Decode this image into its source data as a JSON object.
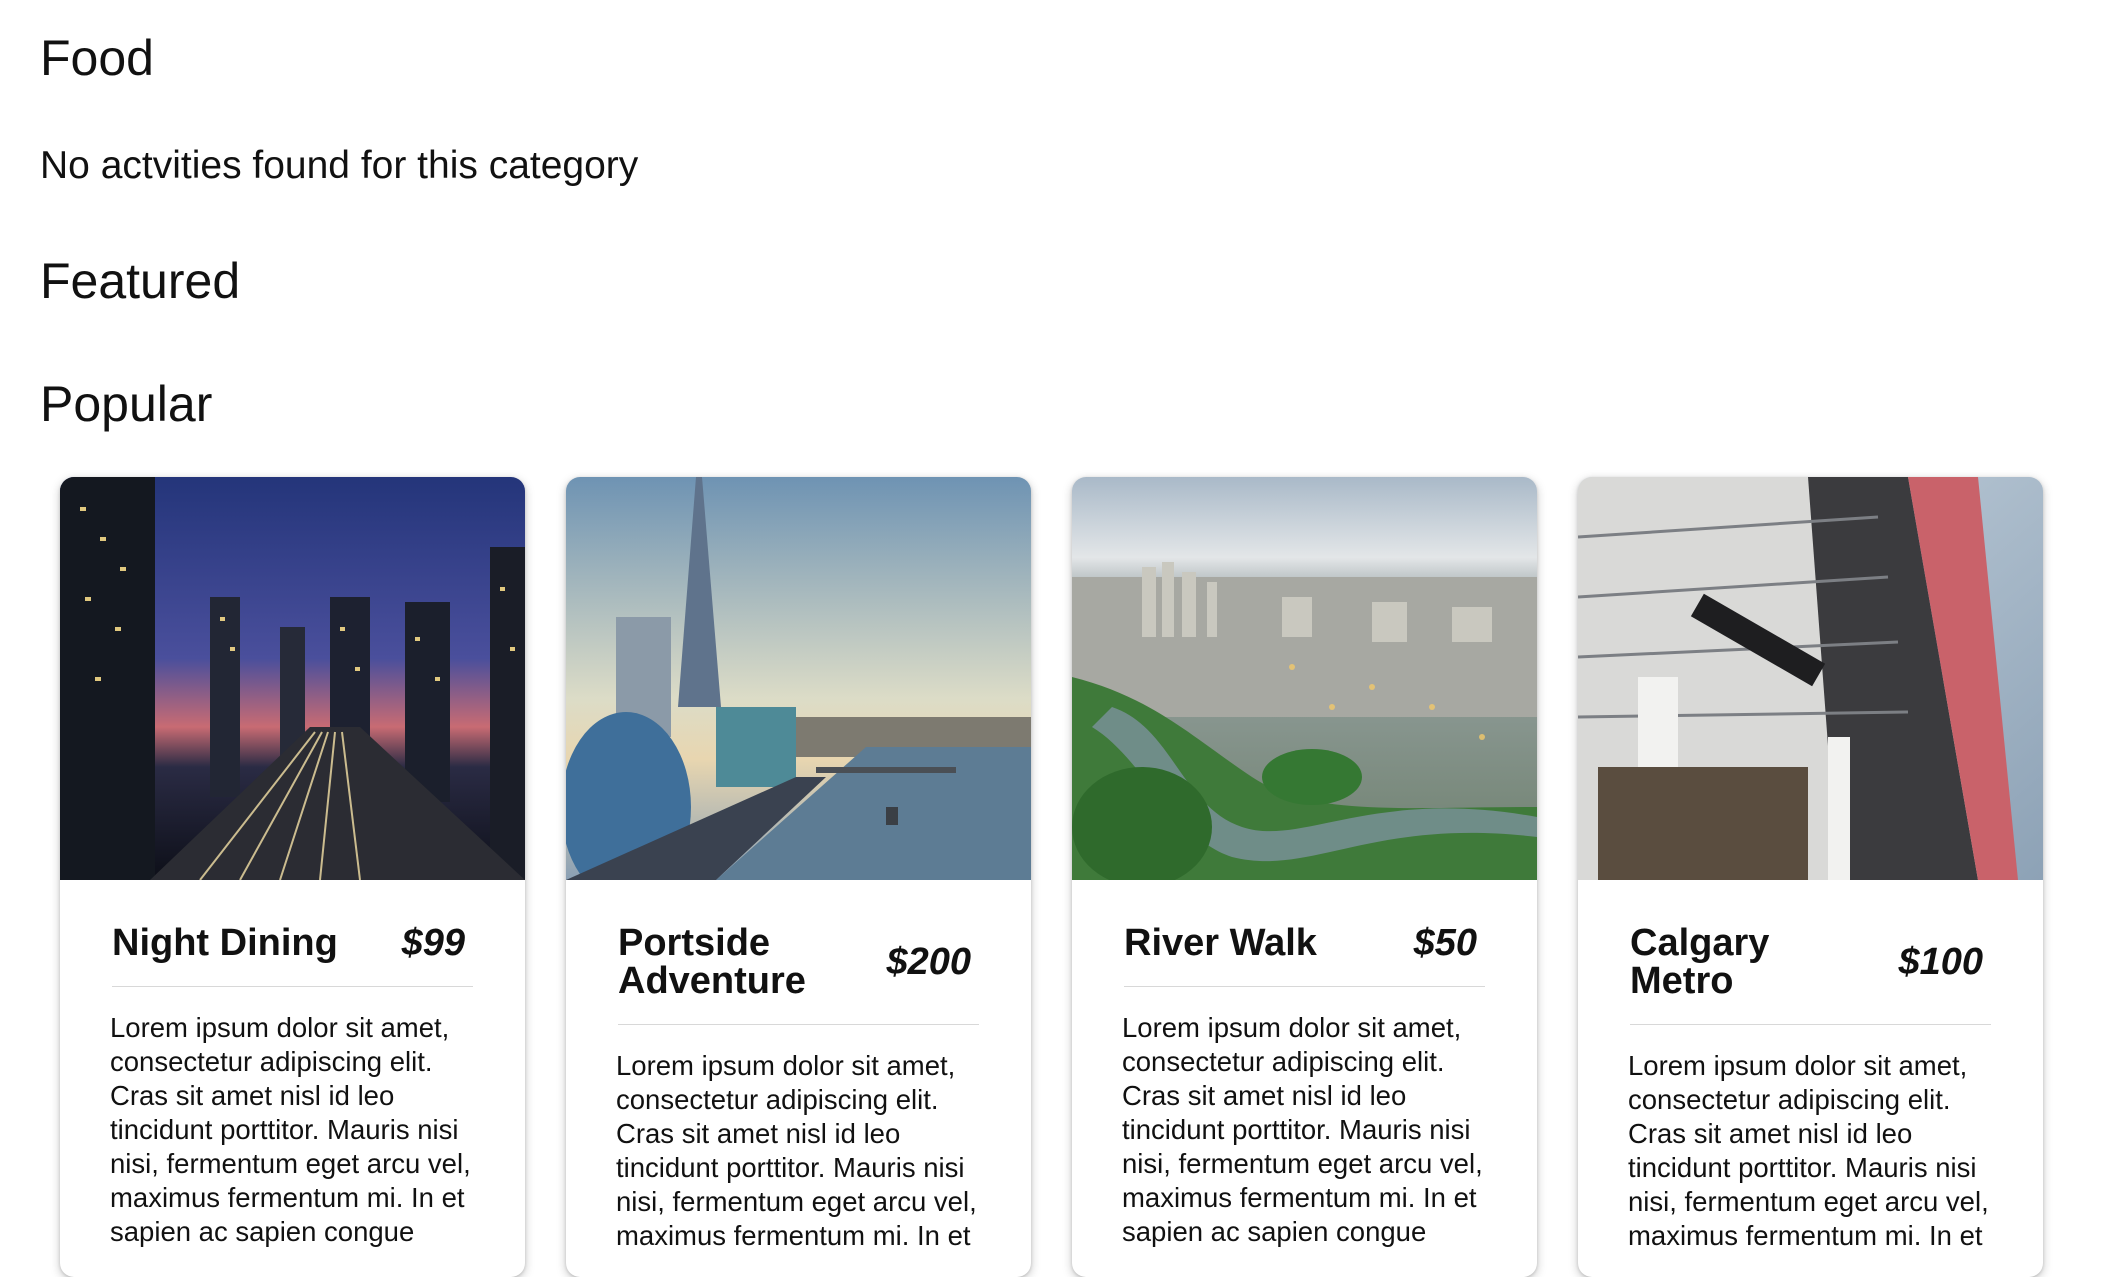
{
  "sections": {
    "food": {
      "title": "Food",
      "empty_message": "No actvities found for this category"
    },
    "featured": {
      "title": "Featured"
    },
    "popular": {
      "title": "Popular"
    }
  },
  "cards": [
    {
      "title": "Night Dining",
      "price": "$99",
      "image": "night-city-skyline-photo",
      "description": "Lorem ipsum dolor sit amet, consectetur adipiscing elit. Cras sit amet nisl id leo tincidunt porttitor. Mauris nisi nisi, fermentum eget arcu vel, maximus fermentum mi. In et sapien ac sapien congue"
    },
    {
      "title": "Portside Adventure",
      "price": "$200",
      "image": "river-city-shard-photo",
      "description": "Lorem ipsum dolor sit amet, consectetur adipiscing elit. Cras sit amet nisl id leo tincidunt porttitor. Mauris nisi nisi, fermentum eget arcu vel, maximus fermentum mi. In et"
    },
    {
      "title": "River Walk",
      "price": "$50",
      "image": "river-park-aerial-photo",
      "description": "Lorem ipsum dolor sit amet, consectetur adipiscing elit. Cras sit amet nisl id leo tincidunt porttitor. Mauris nisi nisi, fermentum eget arcu vel, maximus fermentum mi. In et sapien ac sapien congue"
    },
    {
      "title": "Calgary Metro",
      "price": "$100",
      "image": "metropolitan-building-photo",
      "description": "Lorem ipsum dolor sit amet, consectetur adipiscing elit. Cras sit amet nisl id leo tincidunt porttitor. Mauris nisi nisi, fermentum eget arcu vel, maximus fermentum mi. In et"
    }
  ]
}
